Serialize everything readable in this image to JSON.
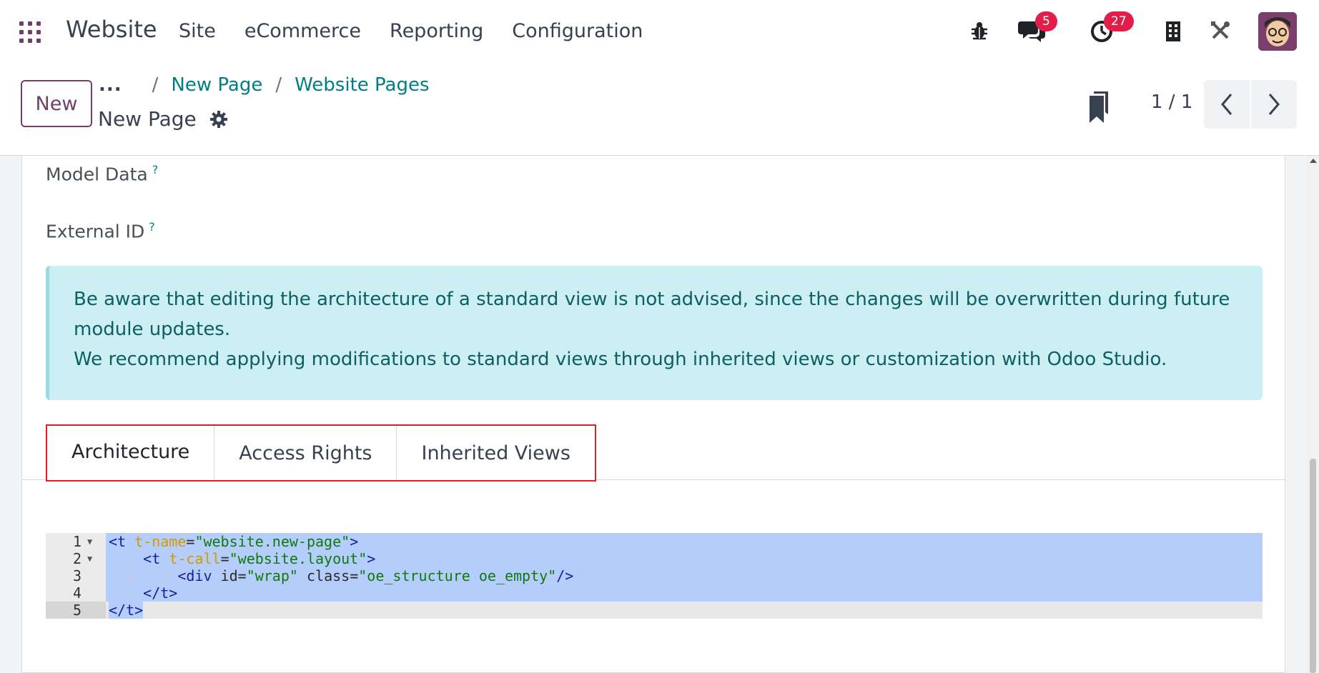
{
  "navbar": {
    "app_title": "Website",
    "menu": [
      "Site",
      "eCommerce",
      "Reporting",
      "Configuration"
    ],
    "messages_badge": "5",
    "activities_badge": "27",
    "accent_color": "#71406a",
    "badge_color": "#e11d48"
  },
  "control_panel": {
    "new_label": "New",
    "breadcrumb": {
      "more": "...",
      "items": [
        "New Page",
        "Website Pages"
      ]
    },
    "record_title": "New Page",
    "pager_value": "1 / 1"
  },
  "form": {
    "model_data_label": "Model Data",
    "external_id_label": "External ID",
    "help_marker": "?",
    "alert_line1": "Be aware that editing the architecture of a standard view is not advised, since the changes will be overwritten during future module updates.",
    "alert_line2": "We recommend applying modifications to standard views through inherited views or customization with Odoo Studio.",
    "tabs": [
      "Architecture",
      "Access Rights",
      "Inherited Views"
    ],
    "active_tab": "Architecture"
  },
  "editor": {
    "line_numbers": [
      "1",
      "2",
      "3",
      "4",
      "5"
    ],
    "line1": {
      "open": "<t",
      "attr": "t-name",
      "eq": "=",
      "val": "\"website.new-page\"",
      "close": ">"
    },
    "line2": {
      "open": "<t",
      "attr": "t-call",
      "eq": "=",
      "val": "\"website.layout\"",
      "close": ">"
    },
    "line3": {
      "open": "<div",
      "attr1": "id",
      "eq": "=",
      "val1": "\"wrap\"",
      "attr2": "class",
      "val2": "\"oe_structure oe_empty\"",
      "close": "/>"
    },
    "line4": {
      "text": "</t>"
    },
    "line5": {
      "text": "</t>"
    }
  }
}
